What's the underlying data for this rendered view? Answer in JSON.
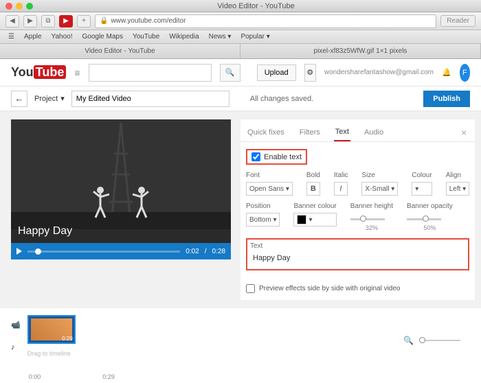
{
  "window": {
    "title": "Video Editor - YouTube"
  },
  "browser": {
    "url": "www.youtube.com/editor",
    "reader": "Reader",
    "bookmarks": [
      "Apple",
      "Yahoo!",
      "Google Maps",
      "YouTube",
      "Wikipedia",
      "News ▾",
      "Popular ▾"
    ],
    "tabs": [
      "Video Editor - YouTube",
      "pixel-xf83z5WfW.gif 1×1 pixels"
    ]
  },
  "header": {
    "logo_you": "You",
    "logo_tube": "Tube",
    "upload": "Upload",
    "email": "wondersharefantashow@gmail.com",
    "avatar_letter": "F"
  },
  "toolbar": {
    "project_label": "Project",
    "project_name": "My Edited Video",
    "save_status": "All changes saved.",
    "publish": "Publish"
  },
  "preview": {
    "overlay_text": "Happy Day",
    "current_time": "0:02",
    "duration": "0:28"
  },
  "tabs": {
    "quick": "Quick fixes",
    "filters": "Filters",
    "text": "Text",
    "audio": "Audio"
  },
  "text_panel": {
    "enable_label": "Enable text",
    "font_label": "Font",
    "font_value": "Open Sans ▾",
    "bold_label": "Bold",
    "italic_label": "Italic",
    "size_label": "Size",
    "size_value": "X-Small ▾",
    "colour_label": "Colour",
    "align_label": "Align",
    "align_value": "Left ▾",
    "position_label": "Position",
    "position_value": "Bottom ▾",
    "banner_colour_label": "Banner colour",
    "banner_height_label": "Banner height",
    "banner_height_value": "32%",
    "banner_opacity_label": "Banner opacity",
    "banner_opacity_value": "50%",
    "text_label": "Text",
    "text_value": "Happy Day"
  },
  "preview_side": "Preview effects side by side with original video",
  "timeline": {
    "clip_time": "0:29",
    "drag_hint": "Drag to timeline",
    "ruler_start": "0:00",
    "ruler_end": "0:29"
  }
}
